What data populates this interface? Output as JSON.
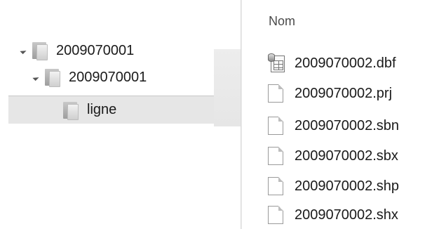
{
  "tree": {
    "nodes": [
      {
        "label": "2009070001",
        "icon": "folder-icon",
        "expanded": true
      },
      {
        "label": "2009070001",
        "icon": "folder-icon",
        "expanded": true
      },
      {
        "label": "ligne",
        "icon": "folder-icon",
        "selected": true
      }
    ]
  },
  "list": {
    "column_header": "Nom",
    "files": [
      {
        "name": "2009070002.dbf",
        "icon": "database-file-icon"
      },
      {
        "name": "2009070002.prj",
        "icon": "document-icon"
      },
      {
        "name": "2009070002.sbn",
        "icon": "document-icon"
      },
      {
        "name": "2009070002.sbx",
        "icon": "document-icon"
      },
      {
        "name": "2009070002.shp",
        "icon": "document-icon"
      },
      {
        "name": "2009070002.shx",
        "icon": "document-icon"
      }
    ]
  },
  "colors": {
    "selection": "#e6e6e6",
    "text": "#1a1a1a",
    "header": "#4a4a4a"
  }
}
